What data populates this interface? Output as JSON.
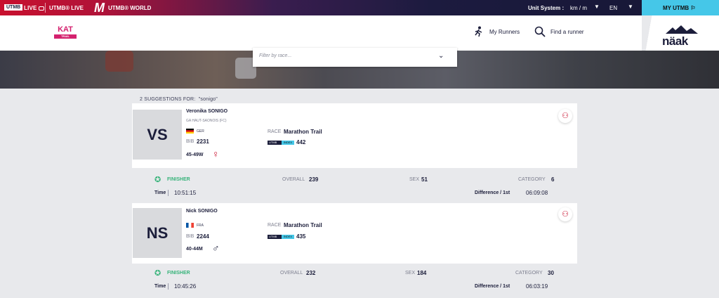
{
  "topbar": {
    "utmb_tag": "UTMB",
    "live": "LIVE",
    "utmb_live": "UTMB® LIVE",
    "utmb_world": "UTMB® WORLD",
    "unit_label": "Unit System :",
    "unit_value": "km / m",
    "language": "EN",
    "my_utmb": "MY UTMB ⚐"
  },
  "header": {
    "event_logo": "KAT",
    "event_logo_sub": "TRAIL",
    "my_runners": "My Runners",
    "find_runner": "Find a runner",
    "sponsor": "näak"
  },
  "filter": {
    "placeholder": "Filter by race..."
  },
  "suggestions": {
    "label": "2 SUGGESTIONS FOR:",
    "query": "\"sonigo\""
  },
  "runners": [
    {
      "initials": "VS",
      "name": "Veronika SONIGO",
      "club": "GA HAUT-SAONOIS (FC)",
      "country": "GER",
      "bib_label": "BIB",
      "bib": "2231",
      "category": "45-49W",
      "sex_symbol": "♀",
      "race_label": "RACE",
      "race": "Marathon Trail",
      "index_badge": "UTMB",
      "index_badge_part": "INDEX",
      "index": "442",
      "status": "FINISHER",
      "overall_label": "OVERALL",
      "overall": "239",
      "sex_label": "SEX",
      "sex_rank": "51",
      "category_label": "CATEGORY",
      "category_rank": "6",
      "time_label": "Time",
      "time": "10:51:15",
      "diff_label": "Difference / 1st",
      "diff": "06:09:08"
    },
    {
      "initials": "NS",
      "name": "Nick SONIGO",
      "club": "",
      "country": "FRA",
      "bib_label": "BIB",
      "bib": "2244",
      "category": "40-44M",
      "sex_symbol": "♂",
      "race_label": "RACE",
      "race": "Marathon Trail",
      "index_badge": "UTMB",
      "index_badge_part": "INDEX",
      "index": "435",
      "status": "FINISHER",
      "overall_label": "OVERALL",
      "overall": "232",
      "sex_label": "SEX",
      "sex_rank": "184",
      "category_label": "CATEGORY",
      "category_rank": "30",
      "time_label": "Time",
      "time": "10:45:26",
      "diff_label": "Difference / 1st",
      "diff": "06:03:19"
    }
  ],
  "colors": {
    "brand_red": "#c8102e",
    "navy": "#1b1d3a",
    "cyan": "#45c7e8",
    "finisher_green": "#37b37a",
    "female_red": "#c8102e"
  },
  "icons": [
    "utmb-m-logo",
    "runner-icon",
    "search-icon",
    "chevron-down-icon",
    "follow-user-icon",
    "medal-icon",
    "flag-icon",
    "female-icon",
    "male-icon"
  ]
}
